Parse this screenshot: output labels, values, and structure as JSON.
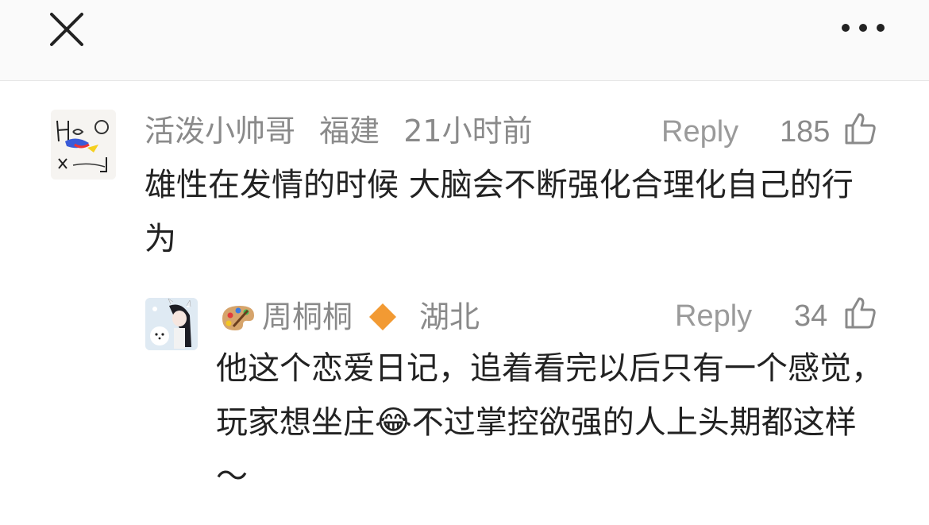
{
  "comments": [
    {
      "username": "活泼小帅哥",
      "location": "福建",
      "time": "21小时前",
      "reply_label": "Reply",
      "likes": "185",
      "text": "雄性在发情的时候 大脑会不断强化合理化自己的行为"
    },
    {
      "username": "周桐桐",
      "location": "湖北",
      "reply_label": "Reply",
      "likes": "34",
      "text_before_emoji": "他这个恋爱日记，追着看完以后只有一个感觉，玩家想坐庄",
      "emoji": "😂",
      "text_after_emoji": "不过掌控欲强的人上头期都这样～"
    }
  ],
  "colors": {
    "meta_text": "#8a8a8a",
    "body_text": "#222222",
    "badge": "#f29a33"
  }
}
